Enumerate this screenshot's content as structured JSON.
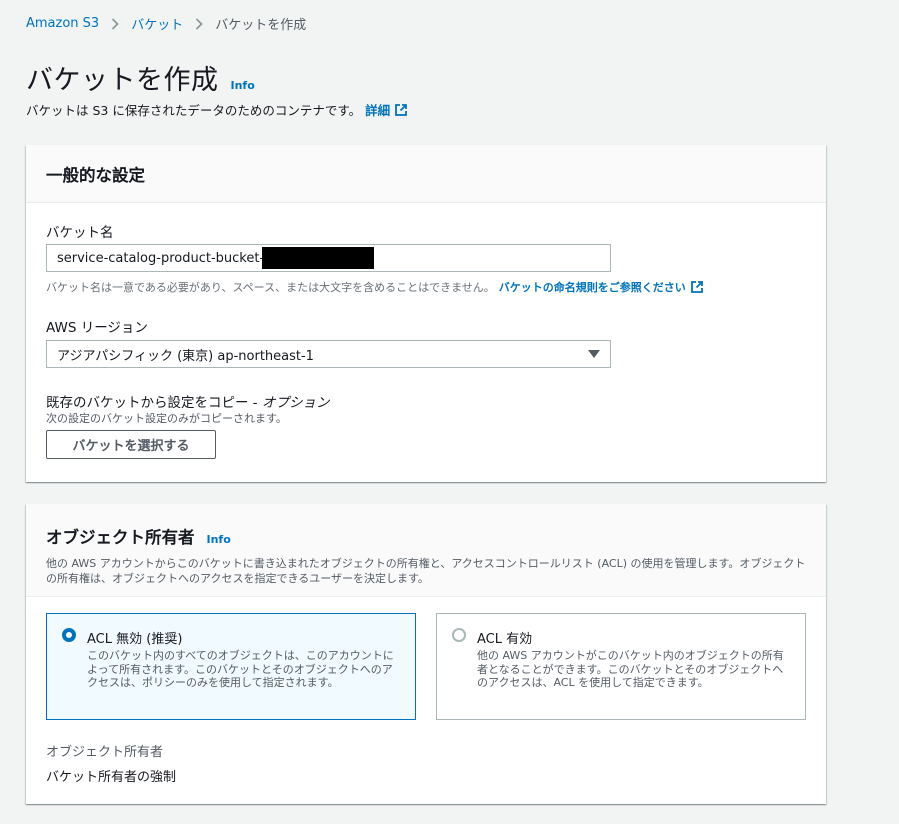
{
  "breadcrumb": {
    "items": [
      "Amazon S3",
      "バケット",
      "バケットを作成"
    ]
  },
  "header": {
    "title": "バケットを作成",
    "info_label": "Info",
    "description": "バケットは S3 に保存されたデータのためのコンテナです。",
    "learn_more_label": "詳細"
  },
  "general": {
    "title": "一般的な設定",
    "bucket_name": {
      "label": "バケット名",
      "value": "service-catalog-product-bucket-",
      "hint": "バケット名は一意である必要があり、スペース、または大文字を含めることはできません。",
      "hint_link": "バケットの命名規則をご参照ください"
    },
    "region": {
      "label": "AWS リージョン",
      "selected": "アジアパシフィック (東京) ap-northeast-1"
    },
    "copy": {
      "title": "既存のバケットから設定をコピー",
      "title_sep": " - ",
      "optional": "オプション",
      "description": "次の設定のバケット設定のみがコピーされます。",
      "button": "バケットを選択する"
    }
  },
  "ownership": {
    "title": "オブジェクト所有者",
    "info_label": "Info",
    "description": "他の AWS アカウントからこのバケットに書き込まれたオブジェクトの所有権と、アクセスコントロールリスト (ACL) の使用を管理します。オブジェクトの所有権は、オブジェクトへのアクセスを指定できるユーザーを決定します。",
    "options": [
      {
        "label": "ACL 無効 (推奨)",
        "description": "このバケット内のすべてのオブジェクトは、このアカウントによって所有されます。このバケットとそのオブジェクトへのアクセスは、ポリシーのみを使用して指定されます。",
        "selected": true
      },
      {
        "label": "ACL 有効",
        "description": "他の AWS アカウントがこのバケット内のオブジェクトの所有者となることができます。このバケットとそのオブジェクトへのアクセスは、ACL を使用して指定できます。",
        "selected": false
      }
    ],
    "field_label": "オブジェクト所有者",
    "field_value": "バケット所有者の強制"
  },
  "colors": {
    "link": "#0073bb",
    "background": "#f2f3f3",
    "selected_tile": "#f1faff"
  }
}
